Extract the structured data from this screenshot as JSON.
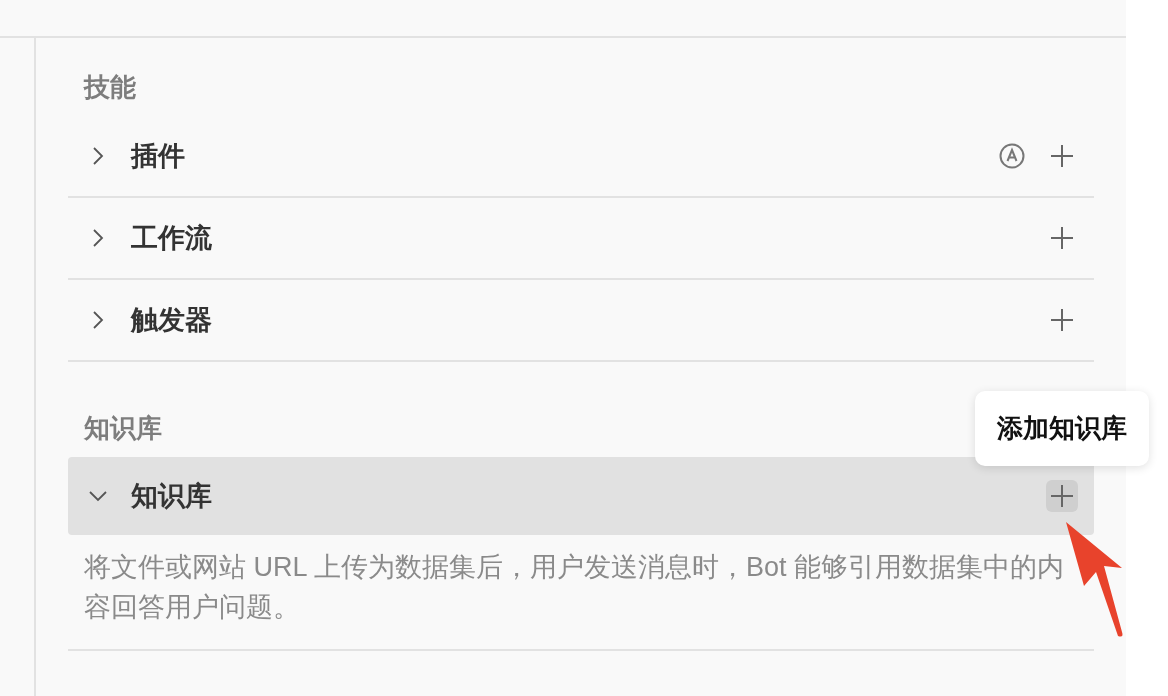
{
  "sections": [
    {
      "heading": "技能",
      "items": [
        {
          "label": "插件",
          "expanded": false,
          "auto_icon": true,
          "add_hovered": false
        },
        {
          "label": "工作流",
          "expanded": false,
          "add_hovered": false
        },
        {
          "label": "触发器",
          "expanded": false,
          "add_hovered": false
        }
      ]
    },
    {
      "heading": "知识库",
      "items": [
        {
          "label": "知识库",
          "expanded": true,
          "add_hovered": true,
          "tooltip": "添加知识库",
          "description": "将文件或网站 URL 上传为数据集后，用户发送消息时，Bot 能够引用数据集中的内容回答用户问题。"
        }
      ]
    }
  ]
}
